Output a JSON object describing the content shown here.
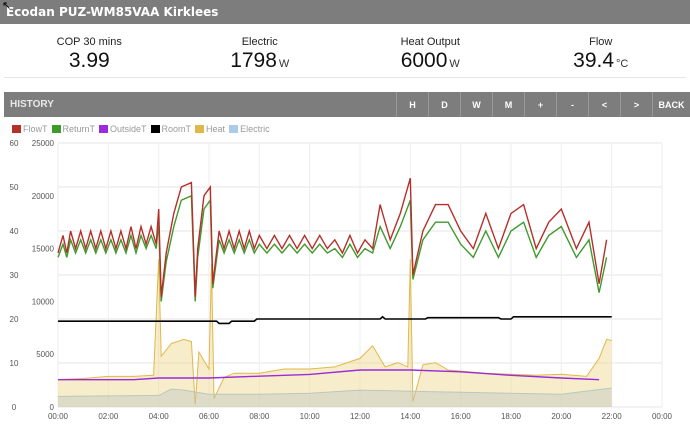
{
  "title": "Ecodan PUZ-WM85VAA Kirklees",
  "stats": [
    {
      "label": "COP 30 mins",
      "value": "3.99",
      "unit": ""
    },
    {
      "label": "Electric",
      "value": "1798",
      "unit": "W"
    },
    {
      "label": "Heat Output",
      "value": "6000",
      "unit": "W"
    },
    {
      "label": "Flow",
      "value": "39.4",
      "unit": "°C"
    }
  ],
  "history": {
    "label": "HISTORY",
    "buttons": [
      "H",
      "D",
      "W",
      "M",
      "+",
      "-",
      "<",
      ">",
      "BACK"
    ]
  },
  "chart_data": {
    "type": "line",
    "legend": [
      {
        "name": "FlowT",
        "color": "#b5302a"
      },
      {
        "name": "ReturnT",
        "color": "#3f9a2e"
      },
      {
        "name": "OutsideT",
        "color": "#9b2bdb"
      },
      {
        "name": "RoomT",
        "color": "#000000"
      },
      {
        "name": "Heat",
        "color": "#e0b84a"
      },
      {
        "name": "Electric",
        "color": "#a9cde8"
      }
    ],
    "x_ticks": [
      "00:00",
      "02:00",
      "04:00",
      "06:00",
      "08:00",
      "10:00",
      "12:00",
      "14:00",
      "16:00",
      "18:00",
      "20:00",
      "22:00",
      "00:00"
    ],
    "y_left": {
      "ticks": [
        0,
        10,
        20,
        30,
        40,
        50,
        60
      ],
      "range": [
        0,
        60
      ]
    },
    "y_right": {
      "ticks": [
        0,
        5000,
        10000,
        15000,
        20000,
        25000
      ],
      "range": [
        0,
        25000
      ]
    },
    "series": [
      {
        "name": "FlowT",
        "axis": "left",
        "points": [
          [
            0,
            35
          ],
          [
            0.2,
            39
          ],
          [
            0.35,
            35
          ],
          [
            0.5,
            40
          ],
          [
            0.7,
            36
          ],
          [
            0.9,
            40
          ],
          [
            1.1,
            36
          ],
          [
            1.3,
            40
          ],
          [
            1.5,
            36
          ],
          [
            1.7,
            40
          ],
          [
            1.9,
            36
          ],
          [
            2.1,
            40
          ],
          [
            2.3,
            36
          ],
          [
            2.5,
            40
          ],
          [
            2.7,
            36
          ],
          [
            2.9,
            41
          ],
          [
            3.1,
            36
          ],
          [
            3.3,
            41
          ],
          [
            3.5,
            37
          ],
          [
            3.7,
            41
          ],
          [
            3.9,
            37
          ],
          [
            4.0,
            45
          ],
          [
            4.1,
            25
          ],
          [
            4.3,
            35
          ],
          [
            4.6,
            44
          ],
          [
            4.9,
            50
          ],
          [
            5.3,
            51
          ],
          [
            5.45,
            25
          ],
          [
            5.55,
            36
          ],
          [
            5.8,
            48
          ],
          [
            6.05,
            50
          ],
          [
            6.15,
            28
          ],
          [
            6.4,
            40
          ],
          [
            6.6,
            36
          ],
          [
            6.8,
            40
          ],
          [
            7,
            36
          ],
          [
            7.2,
            40
          ],
          [
            7.4,
            36
          ],
          [
            7.6,
            40
          ],
          [
            7.8,
            36
          ],
          [
            8,
            39
          ],
          [
            8.3,
            36
          ],
          [
            8.6,
            39
          ],
          [
            8.9,
            36
          ],
          [
            9.2,
            39
          ],
          [
            9.5,
            36
          ],
          [
            9.8,
            39
          ],
          [
            10.1,
            36
          ],
          [
            10.4,
            39
          ],
          [
            10.7,
            36
          ],
          [
            11,
            38
          ],
          [
            11.3,
            35
          ],
          [
            11.6,
            39
          ],
          [
            11.9,
            35
          ],
          [
            12.2,
            38
          ],
          [
            12.5,
            36
          ],
          [
            12.8,
            46
          ],
          [
            13.2,
            38
          ],
          [
            13.6,
            44
          ],
          [
            14.0,
            52
          ],
          [
            14.1,
            30
          ],
          [
            14.5,
            40
          ],
          [
            15,
            46
          ],
          [
            15.5,
            46
          ],
          [
            16,
            40
          ],
          [
            16.5,
            36
          ],
          [
            17,
            44
          ],
          [
            17.5,
            36
          ],
          [
            18,
            44
          ],
          [
            18.5,
            46
          ],
          [
            19,
            36
          ],
          [
            19.5,
            42
          ],
          [
            20,
            45
          ],
          [
            20.6,
            36
          ],
          [
            21.1,
            42
          ],
          [
            21.5,
            28
          ],
          [
            21.8,
            38
          ]
        ]
      },
      {
        "name": "ReturnT",
        "axis": "left",
        "points": [
          [
            0,
            34
          ],
          [
            0.2,
            37
          ],
          [
            0.35,
            34
          ],
          [
            0.5,
            38
          ],
          [
            0.7,
            35
          ],
          [
            0.9,
            38
          ],
          [
            1.1,
            35
          ],
          [
            1.3,
            38
          ],
          [
            1.5,
            35
          ],
          [
            1.7,
            38
          ],
          [
            1.9,
            35
          ],
          [
            2.1,
            38
          ],
          [
            2.3,
            35
          ],
          [
            2.5,
            38
          ],
          [
            2.7,
            35
          ],
          [
            2.9,
            39
          ],
          [
            3.1,
            35
          ],
          [
            3.3,
            39
          ],
          [
            3.5,
            36
          ],
          [
            3.7,
            39
          ],
          [
            3.9,
            36
          ],
          [
            4.0,
            42
          ],
          [
            4.1,
            24
          ],
          [
            4.3,
            33
          ],
          [
            4.6,
            41
          ],
          [
            4.9,
            47
          ],
          [
            5.3,
            48
          ],
          [
            5.45,
            24
          ],
          [
            5.55,
            34
          ],
          [
            5.8,
            45
          ],
          [
            6.05,
            47
          ],
          [
            6.15,
            27
          ],
          [
            6.4,
            38
          ],
          [
            6.6,
            35
          ],
          [
            6.8,
            38
          ],
          [
            7,
            35
          ],
          [
            7.2,
            38
          ],
          [
            7.4,
            35
          ],
          [
            7.6,
            38
          ],
          [
            7.8,
            35
          ],
          [
            8,
            37
          ],
          [
            8.3,
            35
          ],
          [
            8.6,
            37
          ],
          [
            8.9,
            35
          ],
          [
            9.2,
            37
          ],
          [
            9.5,
            35
          ],
          [
            9.8,
            37
          ],
          [
            10.1,
            35
          ],
          [
            10.4,
            37
          ],
          [
            10.7,
            35
          ],
          [
            11,
            36
          ],
          [
            11.3,
            34
          ],
          [
            11.6,
            37
          ],
          [
            11.9,
            34
          ],
          [
            12.2,
            36
          ],
          [
            12.5,
            35
          ],
          [
            12.8,
            41
          ],
          [
            13.2,
            36
          ],
          [
            13.6,
            41
          ],
          [
            14.0,
            47
          ],
          [
            14.1,
            29
          ],
          [
            14.5,
            38
          ],
          [
            15,
            42
          ],
          [
            15.5,
            42
          ],
          [
            16,
            37
          ],
          [
            16.5,
            34
          ],
          [
            17,
            40
          ],
          [
            17.5,
            34
          ],
          [
            18,
            40
          ],
          [
            18.5,
            42
          ],
          [
            19,
            34
          ],
          [
            19.5,
            39
          ],
          [
            20,
            41
          ],
          [
            20.6,
            34
          ],
          [
            21.1,
            38
          ],
          [
            21.5,
            26
          ],
          [
            21.8,
            34
          ]
        ]
      },
      {
        "name": "OutsideT",
        "axis": "left",
        "points": [
          [
            0,
            6.2
          ],
          [
            2,
            6.2
          ],
          [
            3,
            6.2
          ],
          [
            4,
            6.6
          ],
          [
            6,
            6.6
          ],
          [
            8,
            7.0
          ],
          [
            10,
            7.4
          ],
          [
            12,
            8.4
          ],
          [
            14,
            8.4
          ],
          [
            16,
            8.0
          ],
          [
            18,
            7.2
          ],
          [
            20,
            6.6
          ],
          [
            21.5,
            6.2
          ]
        ]
      },
      {
        "name": "RoomT",
        "axis": "left",
        "points": [
          [
            0,
            19.5
          ],
          [
            6.3,
            19.5
          ],
          [
            6.4,
            19
          ],
          [
            6.8,
            19
          ],
          [
            6.9,
            19.5
          ],
          [
            7.8,
            19.5
          ],
          [
            7.9,
            20
          ],
          [
            12.8,
            20
          ],
          [
            12.9,
            20.5
          ],
          [
            13.0,
            20
          ],
          [
            14.6,
            20
          ],
          [
            14.7,
            20.3
          ],
          [
            17.5,
            20.3
          ],
          [
            17.6,
            20
          ],
          [
            18,
            20
          ],
          [
            18.1,
            20.5
          ],
          [
            22,
            20.5
          ]
        ]
      },
      {
        "name": "Heat",
        "axis": "right",
        "points": [
          [
            0,
            2600
          ],
          [
            1,
            2700
          ],
          [
            2,
            2900
          ],
          [
            3,
            2900
          ],
          [
            3.8,
            3000
          ],
          [
            4.0,
            14000
          ],
          [
            4.1,
            4800
          ],
          [
            4.5,
            6000
          ],
          [
            5.0,
            6400
          ],
          [
            5.3,
            6200
          ],
          [
            5.45,
            200
          ],
          [
            5.6,
            5200
          ],
          [
            6.0,
            3600
          ],
          [
            6.1,
            13500
          ],
          [
            6.2,
            800
          ],
          [
            6.6,
            2800
          ],
          [
            7,
            3200
          ],
          [
            8,
            3200
          ],
          [
            9,
            3600
          ],
          [
            10,
            3600
          ],
          [
            11,
            3800
          ],
          [
            12,
            4600
          ],
          [
            12.5,
            5800
          ],
          [
            13,
            3800
          ],
          [
            13.5,
            4200
          ],
          [
            13.9,
            3800
          ],
          [
            14.0,
            14000
          ],
          [
            14.1,
            500
          ],
          [
            14.5,
            4000
          ],
          [
            15,
            4200
          ],
          [
            15.5,
            3500
          ],
          [
            16,
            3400
          ],
          [
            17,
            3200
          ],
          [
            18,
            3100
          ],
          [
            19,
            3000
          ],
          [
            20,
            3100
          ],
          [
            21,
            2900
          ],
          [
            21.5,
            4600
          ],
          [
            21.8,
            6400
          ],
          [
            22,
            6300
          ]
        ]
      },
      {
        "name": "Electric",
        "axis": "right",
        "points": [
          [
            0,
            1000
          ],
          [
            2,
            1050
          ],
          [
            4,
            1100
          ],
          [
            4.5,
            1700
          ],
          [
            5,
            1600
          ],
          [
            6,
            1200
          ],
          [
            8,
            1200
          ],
          [
            10,
            1300
          ],
          [
            12,
            1600
          ],
          [
            14,
            1500
          ],
          [
            16,
            1400
          ],
          [
            18,
            1300
          ],
          [
            20,
            1200
          ],
          [
            22,
            1800
          ]
        ]
      }
    ]
  }
}
